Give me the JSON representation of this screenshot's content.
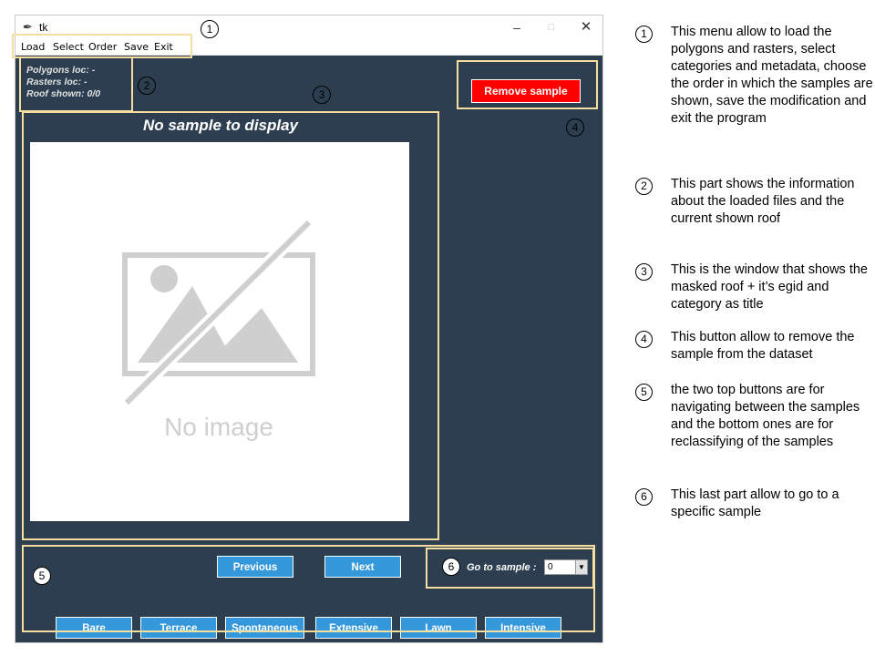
{
  "window": {
    "title": "tk",
    "minimize": "–",
    "maximize": "□",
    "close": "✕"
  },
  "menu": {
    "items": [
      "Load",
      "Select",
      "Order",
      "Save",
      "Exit"
    ]
  },
  "info": {
    "polygons": "Polygons loc: -",
    "rasters": "Rasters loc: -",
    "roof": "Roof shown: 0/0"
  },
  "remove_button": "Remove sample",
  "sample_title": "No sample to display",
  "image_placeholder": "No image",
  "nav": {
    "previous": "Previous",
    "next": "Next"
  },
  "categories": [
    "Bare",
    "Terrace",
    "Spontaneous",
    "Extensive",
    "Lawn",
    "Intensive"
  ],
  "goto": {
    "label": "Go to sample :",
    "value": "0"
  },
  "markers": [
    "1",
    "2",
    "3",
    "4",
    "5",
    "6"
  ],
  "legend": [
    {
      "num": "1",
      "text": "This menu allow to load the polygons and rasters, select categories and metadata, choose the order in which the samples are shown, save the modification and exit the program"
    },
    {
      "num": "2",
      "text": "This part shows the information about the loaded files and the current shown roof"
    },
    {
      "num": "3",
      "text": "This is the window that shows the masked roof + it’s egid and category as title"
    },
    {
      "num": "4",
      "text": "This button allow to remove the sample from the dataset"
    },
    {
      "num": "5",
      "text": "the two top buttons are for navigating between the samples and the bottom ones are for reclassifying of the samples"
    },
    {
      "num": "6",
      "text": "This last part allow to go to a specific sample"
    }
  ],
  "colors": {
    "window_bg": "#2c3e50",
    "button_blue": "#3498db",
    "remove_red": "#ff0000",
    "highlight": "#f5dfa0"
  },
  "icons": [
    "feather-icon",
    "no-image-icon",
    "dropdown-arrow-icon"
  ]
}
